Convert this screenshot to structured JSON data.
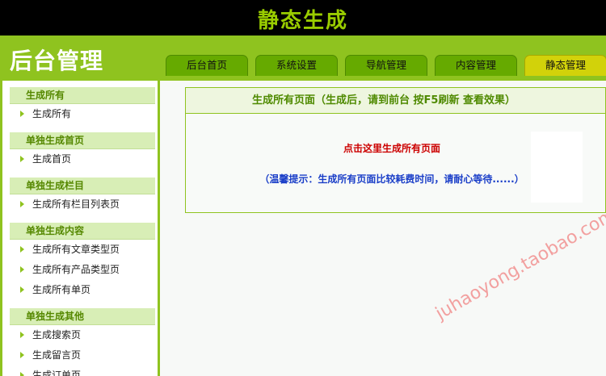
{
  "header": {
    "title": "静态生成"
  },
  "logo": {
    "text": "后台管理"
  },
  "tabs": [
    {
      "label": "后台首页"
    },
    {
      "label": "系统设置"
    },
    {
      "label": "导航管理"
    },
    {
      "label": "内容管理"
    },
    {
      "label": "静态管理"
    }
  ],
  "sidebar": {
    "groups": [
      {
        "title": "生成所有",
        "items": [
          "生成所有"
        ]
      },
      {
        "title": "单独生成首页",
        "items": [
          "生成首页"
        ]
      },
      {
        "title": "单独生成栏目",
        "items": [
          "生成所有栏目列表页"
        ]
      },
      {
        "title": "单独生成内容",
        "items": [
          "生成所有文章类型页",
          "生成所有产品类型页",
          "生成所有单页"
        ]
      },
      {
        "title": "单独生成其他",
        "items": [
          "生成搜索页",
          "生成留言页",
          "生成订单页"
        ]
      }
    ]
  },
  "panel": {
    "title": "生成所有页面（生成后，请到前台 按F5刷新 查看效果）",
    "action_link": "点击这里生成所有页面",
    "hint": "（温馨提示：生成所有页面比较耗费时间，请耐心等待......）"
  },
  "watermark": "juhaoyong.taobao.com",
  "colors": {
    "topbar": "#000000",
    "brand_green": "#8fc31f",
    "title_green": "#99cc00",
    "active_tab": "#d2d20a",
    "link_red": "#cc0000",
    "hint_blue": "#1a3ec8"
  }
}
